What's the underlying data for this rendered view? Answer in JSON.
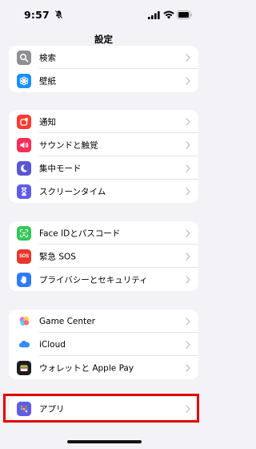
{
  "status_bar": {
    "time": "9:57",
    "icons": [
      "bell-slash-icon",
      "cellular-signal-icon",
      "wifi-icon",
      "battery-icon"
    ]
  },
  "nav": {
    "title": "設定"
  },
  "groups": [
    {
      "items": [
        {
          "label": "検索",
          "icon": "search-icon",
          "color": "#8e8e93"
        },
        {
          "label": "壁紙",
          "icon": "wallpaper-icon",
          "color": "#1c8ef9"
        }
      ]
    },
    {
      "items": [
        {
          "label": "通知",
          "icon": "notifications-icon",
          "color": "#ff3b30"
        },
        {
          "label": "サウンドと触覚",
          "icon": "speaker-icon",
          "color": "#ff2d55"
        },
        {
          "label": "集中モード",
          "icon": "moon-icon",
          "color": "#5856d6"
        },
        {
          "label": "スクリーンタイム",
          "icon": "hourglass-icon",
          "color": "#5e5ce6"
        }
      ]
    },
    {
      "items": [
        {
          "label": "Face IDとパスコード",
          "icon": "face-id-icon",
          "color": "#34c759"
        },
        {
          "label": "緊急 SOS",
          "icon": "sos-icon",
          "icon_text": "SOS",
          "color": "#e8352b"
        },
        {
          "label": "プライバシーとセキュリティ",
          "icon": "hand-icon",
          "color": "#2f7bf5"
        }
      ]
    },
    {
      "items": [
        {
          "label": "Game Center",
          "icon": "game-center-icon",
          "color": "#ffffff"
        },
        {
          "label": "iCloud",
          "icon": "icloud-icon",
          "color": "#ffffff"
        },
        {
          "label": "ウォレットと Apple Pay",
          "icon": "wallet-icon",
          "color": "#1c1c1e"
        }
      ]
    },
    {
      "items": [
        {
          "label": "アプリ",
          "icon": "apps-grid-icon",
          "color": "#5e5ce6"
        }
      ]
    }
  ],
  "highlight_color": "#e00000"
}
